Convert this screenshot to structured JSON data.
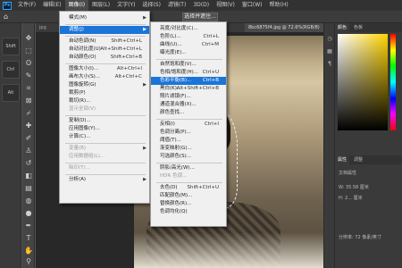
{
  "menubar": {
    "items": [
      "文件(F)",
      "编辑(E)",
      "图像(I)",
      "图层(L)",
      "文字(Y)",
      "选择(S)",
      "滤镜(T)",
      "3D(D)",
      "视图(V)",
      "窗口(W)",
      "帮助(H)"
    ]
  },
  "optionsbar": {
    "button_label": "选择并遮住..."
  },
  "leftpanel": {
    "buttons": [
      "Shift",
      "Ctrl",
      "Alt"
    ]
  },
  "document": {
    "tab_left": "jpg",
    "tab_right": "8bc6875f4.jpg @ 72.6%(RGB/8)"
  },
  "image_menu": {
    "items": [
      {
        "label": "模式(M)",
        "shortcut": "",
        "submenu": true
      },
      {
        "label": "调整(J)",
        "shortcut": "",
        "submenu": true
      },
      {
        "label": "自动色调(N)",
        "shortcut": "Shift+Ctrl+L"
      },
      {
        "label": "自动对比度(U)",
        "shortcut": "Alt+Shift+Ctrl+L"
      },
      {
        "label": "自动颜色(O)",
        "shortcut": "Shift+Ctrl+B"
      },
      {
        "label": "图像大小(I)...",
        "shortcut": "Alt+Ctrl+I"
      },
      {
        "label": "画布大小(S)...",
        "shortcut": "Alt+Ctrl+C"
      },
      {
        "label": "图像旋转(G)",
        "shortcut": "",
        "submenu": true
      },
      {
        "label": "裁剪(P)",
        "shortcut": ""
      },
      {
        "label": "裁切(R)...",
        "shortcut": ""
      },
      {
        "label": "显示全部(V)",
        "shortcut": "",
        "disabled": true
      },
      {
        "label": "复制(D)...",
        "shortcut": ""
      },
      {
        "label": "应用图像(Y)...",
        "shortcut": ""
      },
      {
        "label": "计算(C)...",
        "shortcut": ""
      },
      {
        "label": "变量(B)",
        "shortcut": "",
        "submenu": true,
        "disabled": true
      },
      {
        "label": "应用数据组(L)...",
        "shortcut": "",
        "disabled": true
      },
      {
        "label": "陷印(T)...",
        "shortcut": "",
        "disabled": true
      },
      {
        "label": "分析(A)",
        "shortcut": "",
        "submenu": true
      }
    ]
  },
  "adjust_menu": {
    "items": [
      {
        "label": "亮度/对比度(C)...",
        "shortcut": ""
      },
      {
        "label": "色阶(L)...",
        "shortcut": "Ctrl+L"
      },
      {
        "label": "曲线(U)...",
        "shortcut": "Ctrl+M"
      },
      {
        "label": "曝光度(E)...",
        "shortcut": ""
      },
      {
        "label": "自然饱和度(V)...",
        "shortcut": ""
      },
      {
        "label": "色相/饱和度(H)...",
        "shortcut": "Ctrl+U"
      },
      {
        "label": "色彩平衡(B)...",
        "shortcut": "Ctrl+B",
        "highlighted": true
      },
      {
        "label": "黑白(K)...",
        "shortcut": "Alt+Shift+Ctrl+B"
      },
      {
        "label": "照片滤镜(F)...",
        "shortcut": ""
      },
      {
        "label": "通道混合器(X)...",
        "shortcut": ""
      },
      {
        "label": "颜色查找...",
        "shortcut": ""
      },
      {
        "label": "反相(I)",
        "shortcut": "Ctrl+I"
      },
      {
        "label": "色调分离(P)...",
        "shortcut": ""
      },
      {
        "label": "阈值(T)...",
        "shortcut": ""
      },
      {
        "label": "渐变映射(G)...",
        "shortcut": ""
      },
      {
        "label": "可选颜色(S)...",
        "shortcut": ""
      },
      {
        "label": "阴影/高光(W)...",
        "shortcut": ""
      },
      {
        "label": "HDR 色调...",
        "shortcut": "",
        "disabled": true
      },
      {
        "label": "去色(D)",
        "shortcut": "Shift+Ctrl+U"
      },
      {
        "label": "匹配颜色(M)...",
        "shortcut": ""
      },
      {
        "label": "替换颜色(R)...",
        "shortcut": ""
      },
      {
        "label": "色调均化(Q)",
        "shortcut": ""
      }
    ]
  },
  "right_panel": {
    "tabs": [
      "颜色",
      "色板"
    ],
    "props_tabs": [
      "属性",
      "调整"
    ],
    "doc_props_title": "文档属性",
    "width_label": "W: 35.58 厘米",
    "height_label": "H: 2... 厘米",
    "res_label": "分辨率: 72 像素/英寸"
  },
  "colors": {
    "accent": "#1b75d9",
    "menu_bg": "#f0f0f0"
  }
}
